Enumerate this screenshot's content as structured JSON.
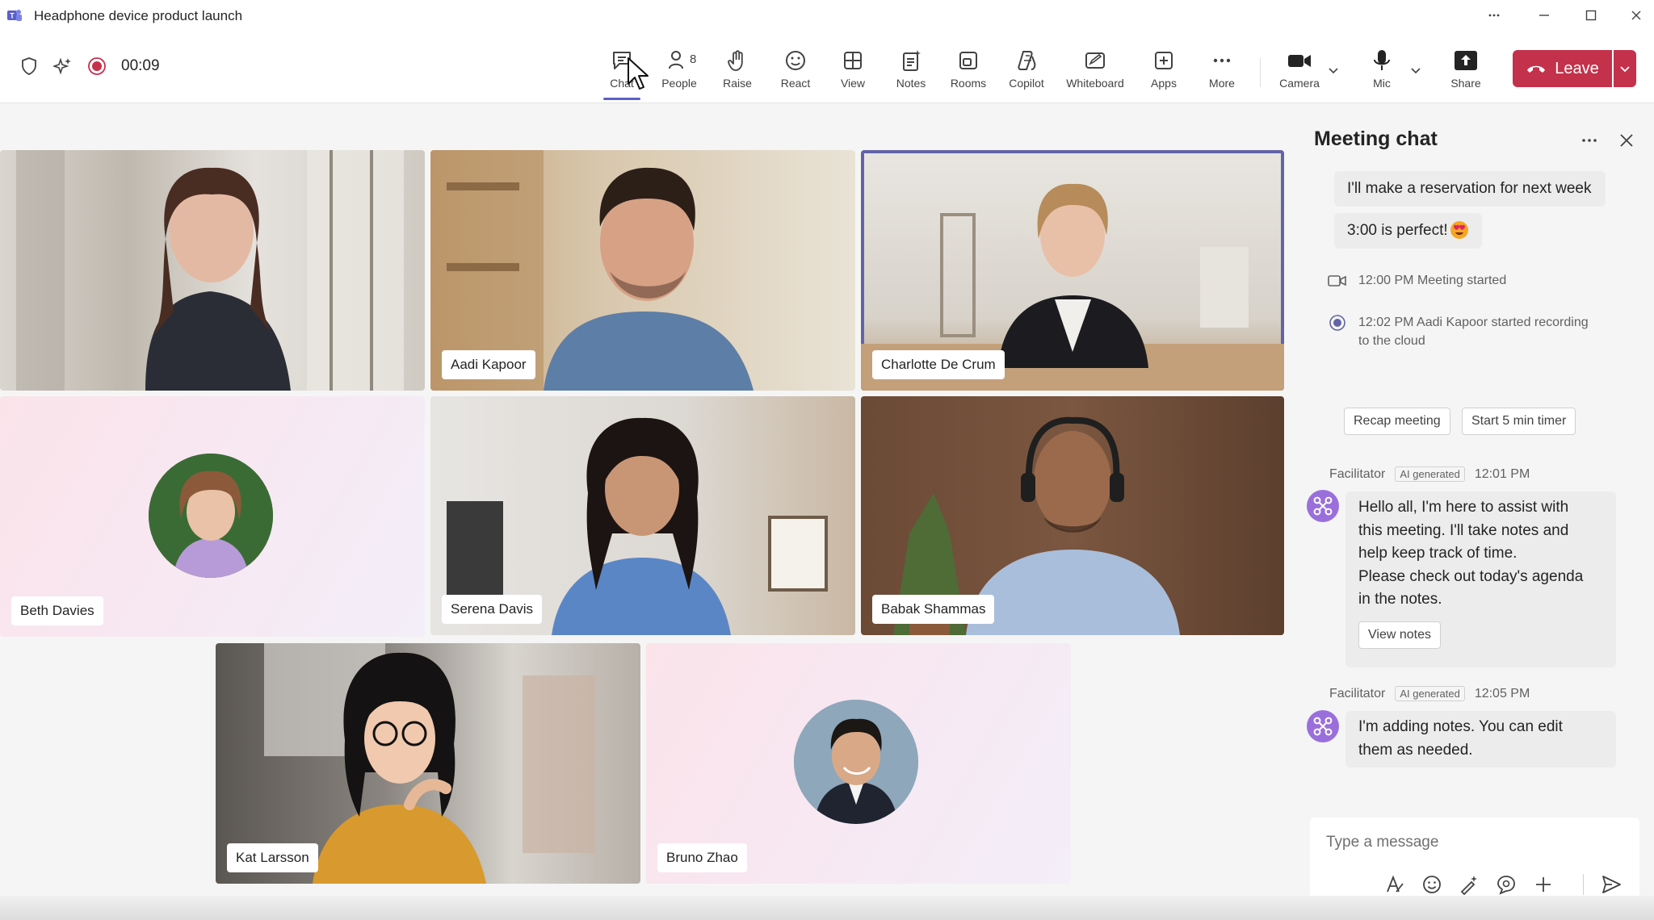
{
  "window": {
    "title": "Headphone device product launch"
  },
  "toolbar": {
    "timer": "00:09",
    "people_count": "8",
    "tools": [
      {
        "id": "chat",
        "label": "Chat"
      },
      {
        "id": "people",
        "label": "People"
      },
      {
        "id": "raise",
        "label": "Raise"
      },
      {
        "id": "react",
        "label": "React"
      },
      {
        "id": "view",
        "label": "View"
      },
      {
        "id": "notes",
        "label": "Notes"
      },
      {
        "id": "rooms",
        "label": "Rooms"
      },
      {
        "id": "copilot",
        "label": "Copilot"
      },
      {
        "id": "whiteboard",
        "label": "Whiteboard"
      },
      {
        "id": "apps",
        "label": "Apps"
      },
      {
        "id": "more",
        "label": "More"
      },
      {
        "id": "camera",
        "label": "Camera"
      },
      {
        "id": "mic",
        "label": "Mic"
      },
      {
        "id": "share",
        "label": "Share"
      }
    ],
    "leave_label": "Leave",
    "leave_color": "#c4314b",
    "accent_color": "#5b5fc7"
  },
  "participants": [
    {
      "name": ""
    },
    {
      "name": "Aadi Kapoor"
    },
    {
      "name": "Charlotte De Crum"
    },
    {
      "name": "Beth Davies"
    },
    {
      "name": "Serena Davis"
    },
    {
      "name": "Babak Shammas"
    },
    {
      "name": "Kat Larsson"
    },
    {
      "name": "Bruno Zhao"
    }
  ],
  "chat": {
    "title": "Meeting chat",
    "messages": [
      {
        "text": "I'll make a reservation for next week"
      },
      {
        "text": "3:00 is perfect!",
        "emoji": "heart-eyes-emoji"
      }
    ],
    "events": [
      {
        "time": "12:00 PM",
        "text": "Meeting started",
        "icon": "video-camera-icon"
      },
      {
        "time": "12:02 PM",
        "text": "Aadi Kapoor started recording",
        "text2": "to the cloud",
        "icon": "recording-icon"
      }
    ],
    "suggestions": [
      "Recap meeting",
      "Start 5 min timer"
    ],
    "bot_messages": [
      {
        "sender": "Facilitator",
        "badge": "AI generated",
        "time": "12:01 PM",
        "lines": [
          "Hello all, I'm here to assist with",
          "this meeting. I'll take notes and",
          "help keep track of time.",
          "Please check out today's agenda",
          "in the notes."
        ],
        "button": "View notes"
      },
      {
        "sender": "Facilitator",
        "badge": "AI generated",
        "time": "12:05 PM",
        "lines": [
          "I'm adding notes. You can edit",
          "them as needed."
        ]
      }
    ],
    "compose_placeholder": "Type a message"
  }
}
